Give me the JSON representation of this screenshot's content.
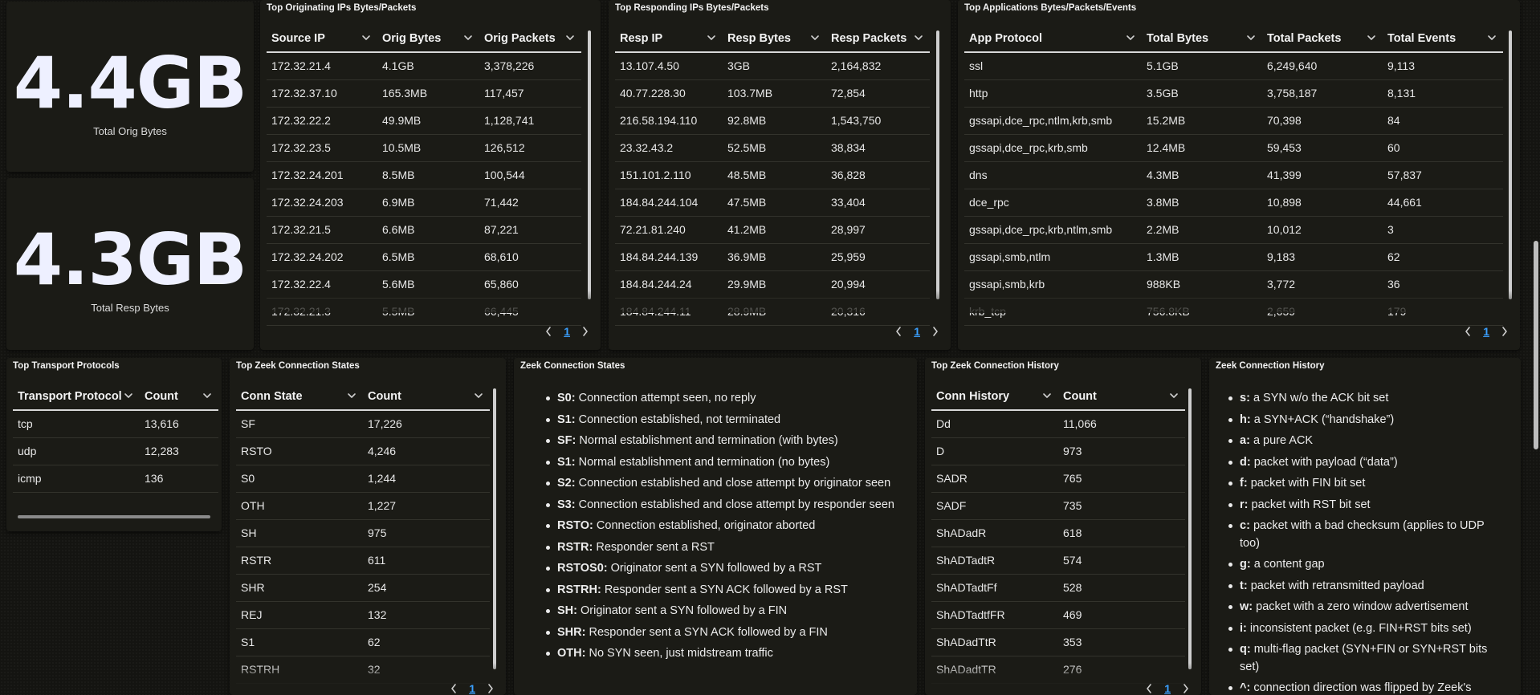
{
  "metrics": {
    "orig": {
      "value": "4.4GB",
      "label": "Total Orig Bytes"
    },
    "resp": {
      "value": "4.3GB",
      "label": "Total Resp Bytes"
    }
  },
  "orig_ips": {
    "title": "Top Originating IPs Bytes/Packets",
    "columns": [
      "Source IP",
      "Orig Bytes",
      "Orig Packets"
    ],
    "rows": [
      [
        "172.32.21.4",
        "4.1GB",
        "3,378,226"
      ],
      [
        "172.32.37.10",
        "165.3MB",
        "117,457"
      ],
      [
        "172.32.22.2",
        "49.9MB",
        "1,128,741"
      ],
      [
        "172.32.23.5",
        "10.5MB",
        "126,512"
      ],
      [
        "172.32.24.201",
        "8.5MB",
        "100,544"
      ],
      [
        "172.32.24.203",
        "6.9MB",
        "71,442"
      ],
      [
        "172.32.21.5",
        "6.6MB",
        "87,221"
      ],
      [
        "172.32.24.202",
        "6.5MB",
        "68,610"
      ],
      [
        "172.32.22.4",
        "5.6MB",
        "65,860"
      ],
      [
        "172.32.21.3",
        "5.5MB",
        "66,445"
      ]
    ],
    "page": "1"
  },
  "resp_ips": {
    "title": "Top Responding IPs Bytes/Packets",
    "columns": [
      "Resp IP",
      "Resp Bytes",
      "Resp Packets"
    ],
    "rows": [
      [
        "13.107.4.50",
        "3GB",
        "2,164,832"
      ],
      [
        "40.77.228.30",
        "103.7MB",
        "72,854"
      ],
      [
        "216.58.194.110",
        "92.8MB",
        "1,543,750"
      ],
      [
        "23.32.43.2",
        "52.5MB",
        "38,834"
      ],
      [
        "151.101.2.110",
        "48.5MB",
        "36,828"
      ],
      [
        "184.84.244.104",
        "47.5MB",
        "33,404"
      ],
      [
        "72.21.81.240",
        "41.2MB",
        "28,997"
      ],
      [
        "184.84.244.139",
        "36.9MB",
        "25,959"
      ],
      [
        "184.84.244.24",
        "29.9MB",
        "20,994"
      ],
      [
        "184.84.244.11",
        "28.9MB",
        "20,316"
      ]
    ],
    "page": "1"
  },
  "apps": {
    "title": "Top Applications Bytes/Packets/Events",
    "columns": [
      "App Protocol",
      "Total Bytes",
      "Total Packets",
      "Total Events"
    ],
    "rows": [
      [
        "ssl",
        "5.1GB",
        "6,249,640",
        "9,113"
      ],
      [
        "http",
        "3.5GB",
        "3,758,187",
        "8,131"
      ],
      [
        "gssapi,dce_rpc,ntlm,krb,smb",
        "15.2MB",
        "70,398",
        "84"
      ],
      [
        "gssapi,dce_rpc,krb,smb",
        "12.4MB",
        "59,453",
        "60"
      ],
      [
        "dns",
        "4.3MB",
        "41,399",
        "57,837"
      ],
      [
        "dce_rpc",
        "3.8MB",
        "10,898",
        "44,661"
      ],
      [
        "gssapi,dce_rpc,krb,ntlm,smb",
        "2.2MB",
        "10,012",
        "3"
      ],
      [
        "gssapi,smb,ntlm",
        "1.3MB",
        "9,183",
        "62"
      ],
      [
        "gssapi,smb,krb",
        "988KB",
        "3,772",
        "36"
      ],
      [
        "krb_tcp",
        "756.8KB",
        "2,659",
        "179"
      ]
    ],
    "page": "1"
  },
  "transport": {
    "title": "Top Transport Protocols",
    "columns": [
      "Transport Protocol",
      "Count"
    ],
    "rows": [
      [
        "tcp",
        "13,616"
      ],
      [
        "udp",
        "12,283"
      ],
      [
        "icmp",
        "136"
      ]
    ]
  },
  "conn_states": {
    "title": "Top Zeek Connection States",
    "columns": [
      "Conn State",
      "Count"
    ],
    "rows": [
      [
        "SF",
        "17,226"
      ],
      [
        "RSTO",
        "4,246"
      ],
      [
        "S0",
        "1,244"
      ],
      [
        "OTH",
        "1,227"
      ],
      [
        "SH",
        "975"
      ],
      [
        "RSTR",
        "611"
      ],
      [
        "SHR",
        "254"
      ],
      [
        "REJ",
        "132"
      ],
      [
        "S1",
        "62"
      ],
      [
        "RSTRH",
        "32"
      ]
    ],
    "page": "1"
  },
  "conn_states_desc": {
    "title": "Zeek Connection States",
    "items": [
      {
        "k": "S0",
        "v": "Connection attempt seen, no reply"
      },
      {
        "k": "S1",
        "v": "Connection established, not terminated"
      },
      {
        "k": "SF",
        "v": "Normal establishment and termination (with bytes)"
      },
      {
        "k": "S1",
        "v": "Normal establishment and termination (no bytes)"
      },
      {
        "k": "S2",
        "v": "Connection established and close attempt by originator seen"
      },
      {
        "k": "S3",
        "v": "Connection established and close attempt by responder seen"
      },
      {
        "k": "RSTO",
        "v": "Connection established, originator aborted"
      },
      {
        "k": "RSTR",
        "v": "Responder sent a RST"
      },
      {
        "k": "RSTOS0",
        "v": "Originator sent a SYN followed by a RST"
      },
      {
        "k": "RSTRH",
        "v": "Responder sent a SYN ACK followed by a RST"
      },
      {
        "k": "SH",
        "v": "Originator sent a SYN followed by a FIN"
      },
      {
        "k": "SHR",
        "v": "Responder sent a SYN ACK followed by a FIN"
      },
      {
        "k": "OTH",
        "v": "No SYN seen, just midstream traffic"
      }
    ]
  },
  "conn_history": {
    "title": "Top Zeek Connection History",
    "columns": [
      "Conn History",
      "Count"
    ],
    "rows": [
      [
        "Dd",
        "11,066"
      ],
      [
        "D",
        "973"
      ],
      [
        "SADR",
        "765"
      ],
      [
        "SADF",
        "735"
      ],
      [
        "ShADadR",
        "618"
      ],
      [
        "ShADTadtR",
        "574"
      ],
      [
        "ShADTadtFf",
        "528"
      ],
      [
        "ShADTadtfFR",
        "469"
      ],
      [
        "ShADadTtR",
        "353"
      ],
      [
        "ShADadtTR",
        "276"
      ]
    ],
    "page": "1"
  },
  "conn_history_desc": {
    "title": "Zeek Connection History",
    "items": [
      {
        "k": "s",
        "v": "a SYN w/o the ACK bit set"
      },
      {
        "k": "h",
        "v": "a SYN+ACK (“handshake”)"
      },
      {
        "k": "a",
        "v": "a pure ACK"
      },
      {
        "k": "d",
        "v": "packet with payload (“data”)"
      },
      {
        "k": "f",
        "v": "packet with FIN bit set"
      },
      {
        "k": "r",
        "v": "packet with RST bit set"
      },
      {
        "k": "c",
        "v": "packet with a bad checksum (applies to UDP too)"
      },
      {
        "k": "g",
        "v": "a content gap"
      },
      {
        "k": "t",
        "v": "packet with retransmitted payload"
      },
      {
        "k": "w",
        "v": "packet with a zero window advertisement"
      },
      {
        "k": "i",
        "v": "inconsistent packet (e.g. FIN+RST bits set)"
      },
      {
        "k": "q",
        "v": "multi-flag packet (SYN+FIN or SYN+RST bits set)"
      },
      {
        "k": "^",
        "v": "connection direction was flipped by Zeek's"
      }
    ]
  },
  "icons": {
    "sort": "chevron-down-icon",
    "prev": "chevron-left-icon",
    "next": "chevron-right-icon"
  },
  "colors": {
    "background": "#141411",
    "panel": "#1b1b16",
    "accent": "#3aa0ff",
    "metric_text": "#eef0ff"
  }
}
